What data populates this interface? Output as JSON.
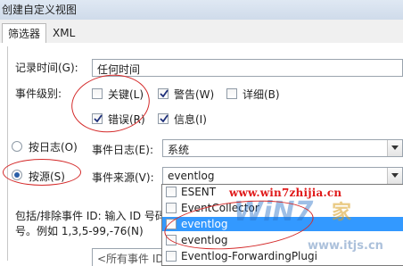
{
  "window": {
    "title": "创建自定义视图"
  },
  "tabs": [
    {
      "label": "筛选器"
    },
    {
      "label": "XML"
    }
  ],
  "filter": {
    "logged_label": "记录时间(G):",
    "logged_value": "任何时间",
    "level_label": "事件级别:",
    "levels": [
      {
        "label": "关键(L)",
        "checked": false
      },
      {
        "label": "警告(W)",
        "checked": true
      },
      {
        "label": "详细(B)",
        "checked": false
      },
      {
        "label": "错误(R)",
        "checked": true
      },
      {
        "label": "信息(I)",
        "checked": true
      }
    ],
    "by_log_label": "按日志(O)",
    "by_source_label": "按源(S)",
    "event_logs_label": "事件日志(E):",
    "event_logs_value": "系统",
    "event_sources_label": "事件来源(V):",
    "event_sources_value": "eventlog",
    "include_label_line1": "包括/排除事件 ID: 输入 ID 号码",
    "include_label_line2": "号。例如 1,3,5-99,-76(N)",
    "all_event_ids": "<所有事件 ID>"
  },
  "source_list": [
    {
      "label": "ESENT",
      "checked": false,
      "selected": false
    },
    {
      "label": "EventCollector",
      "checked": false,
      "selected": false
    },
    {
      "label": "eventlog",
      "checked": false,
      "selected": true
    },
    {
      "label": "eventlog",
      "checked": false,
      "selected": false
    },
    {
      "label": "Eventlog-ForwardingPlugi",
      "checked": false,
      "selected": false
    }
  ],
  "watermark": {
    "url": "www.win7zhijia.cn",
    "logo": "WiN7",
    "url2": "www.itjs.cn",
    "stamp": "家"
  },
  "colors": {
    "highlight": "#3399ff",
    "annotation": "#d42a2a",
    "check": "#1e2f7a"
  }
}
